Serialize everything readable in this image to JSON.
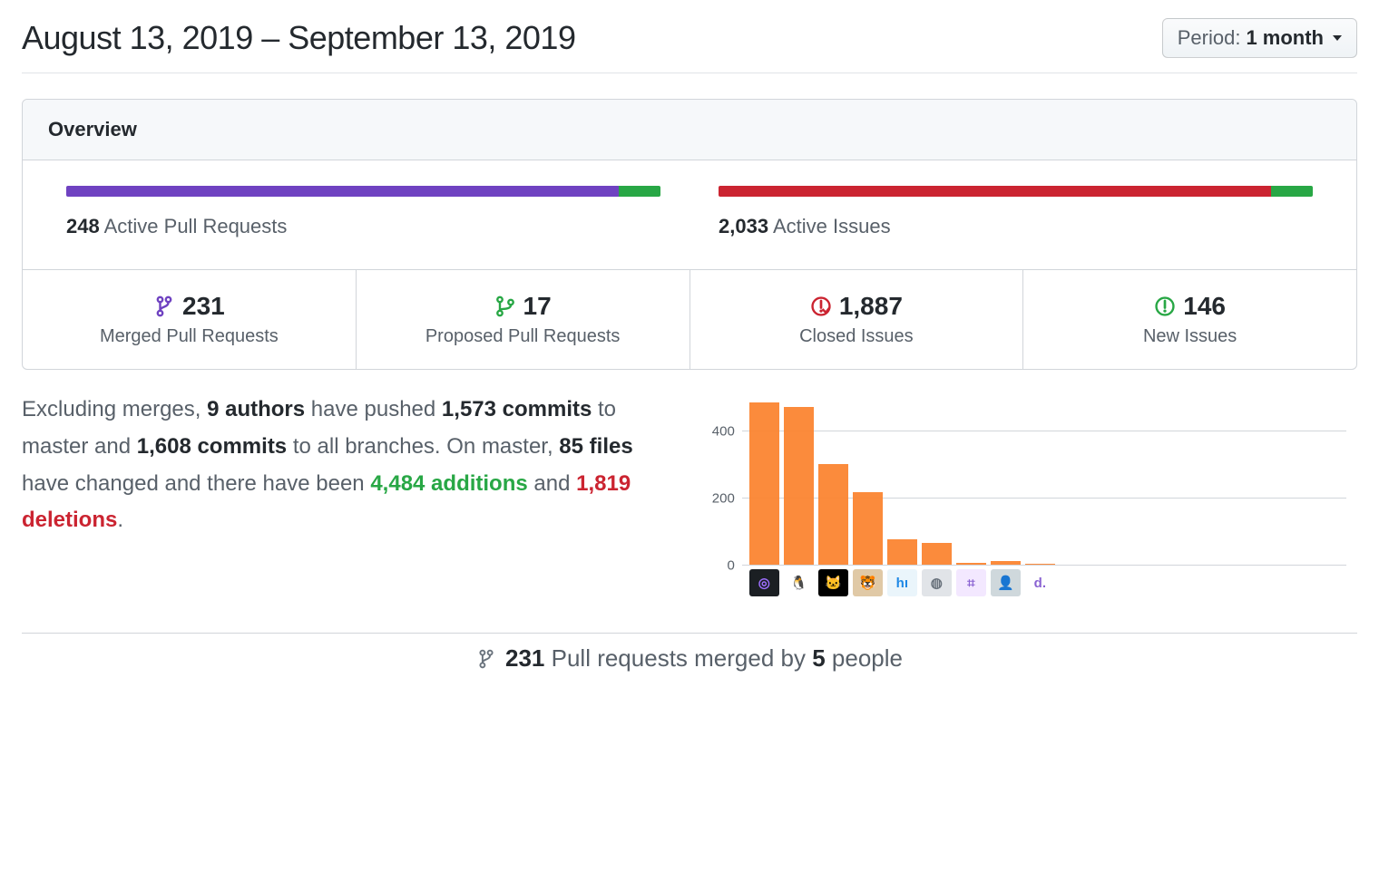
{
  "header": {
    "title": "August 13, 2019 – September 13, 2019",
    "period_label": "Period:",
    "period_value": "1 month"
  },
  "overview": {
    "label": "Overview",
    "pull_requests": {
      "count": "248",
      "label": "Active Pull Requests",
      "bar_primary_pct": 93,
      "bar_secondary_pct": 7
    },
    "issues": {
      "count": "2,033",
      "label": "Active Issues",
      "bar_primary_pct": 93,
      "bar_secondary_pct": 7
    },
    "stats": [
      {
        "icon": "git-merge",
        "color": "c-purple",
        "value": "231",
        "label": "Merged Pull Requests"
      },
      {
        "icon": "git-branch",
        "color": "c-green",
        "value": "17",
        "label": "Proposed Pull Requests"
      },
      {
        "icon": "issue-closed",
        "color": "c-red",
        "value": "1,887",
        "label": "Closed Issues"
      },
      {
        "icon": "issue-open",
        "color": "c-green",
        "value": "146",
        "label": "New Issues"
      }
    ]
  },
  "summary": {
    "t1": "Excluding merges, ",
    "authors": "9 authors",
    "t2": " have pushed ",
    "commits_master": "1,573 commits",
    "t3": " to master and ",
    "commits_all": "1,608 commits",
    "t4": " to all branches. On master, ",
    "files": "85 files",
    "t5": " have changed and there have been ",
    "additions": "4,484 additions",
    "t6": " and ",
    "deletions": "1,819 deletions",
    "t7": "."
  },
  "chart_data": {
    "type": "bar",
    "categories": [
      "a1",
      "a2",
      "a3",
      "a4",
      "a5",
      "a6",
      "a7",
      "a8",
      "a9"
    ],
    "values": [
      485,
      470,
      300,
      215,
      75,
      65,
      6,
      10,
      3
    ],
    "title": "",
    "xlabel": "",
    "ylabel": "",
    "ylim": [
      0,
      500
    ],
    "yticks": [
      0,
      200,
      400
    ]
  },
  "avatars": [
    {
      "bg": "#1b1f23",
      "fg": "#9e6fff",
      "txt": "◎"
    },
    {
      "bg": "#ffffff",
      "fg": "#000",
      "txt": "🐧"
    },
    {
      "bg": "#000000",
      "fg": "#ffb000",
      "txt": "🐱"
    },
    {
      "bg": "#e0c9a6",
      "fg": "#6b4f2a",
      "txt": "🐯"
    },
    {
      "bg": "#eaf5fb",
      "fg": "#1e88e5",
      "txt": "hı"
    },
    {
      "bg": "#e1e4e8",
      "fg": "#6a737d",
      "txt": "◍"
    },
    {
      "bg": "#f3e8ff",
      "fg": "#8a63d2",
      "txt": "⌗"
    },
    {
      "bg": "#cfd8dc",
      "fg": "#546e7a",
      "txt": "👤"
    },
    {
      "bg": "#ffffff",
      "fg": "#8a63d2",
      "txt": "d."
    }
  ],
  "footer": {
    "count": "231",
    "mid": " Pull requests merged by ",
    "people": "5",
    "suffix": " people"
  }
}
